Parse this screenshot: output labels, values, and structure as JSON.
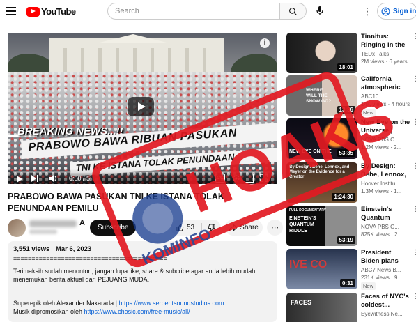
{
  "header": {
    "logo_text": "YouTube",
    "search_placeholder": "Search",
    "signin_label": "Sign in"
  },
  "player": {
    "breaking_text": "BREAKING NEWS...!!",
    "banner_line1": "PRABOWO BAWA RIBUAN PASUKAN",
    "banner_line2": "TNI KE ISTANA TOLAK PENUNDAAN",
    "time": "0:00 / 5:",
    "progress": 0.0
  },
  "video": {
    "title": "PRABOWO BAWA PASUKAN TNI KE ISTANA TOLAK PENUNDAAN PEMILU",
    "channel_suffix": "A",
    "subscribe_label": "Subscribe",
    "likes": "53",
    "share_label": "Share"
  },
  "description": {
    "views": "3,551 views",
    "date": "Mar 6, 2023",
    "separator": "==========================================",
    "paragraph": "Terimaksih sudah menonton, jangan lupa like, share & subcribe agar anda lebih mudah menemukan berita aktual dari PEJUANG MUDA.",
    "credit1_prefix": "Superepik oleh Alexander Nakarada | ",
    "credit1_link": "https://www.serpentsoundstudios.com",
    "credit2_prefix": "Musik dipromosikan oleh ",
    "credit2_link": "https://www.chosic.com/free-music/all/"
  },
  "recommendations": [
    {
      "title": "Tinnitus: Ringing in the Brain |",
      "channel": "TEDx Talks",
      "meta": "2M views · 6 years",
      "badge": "",
      "duration": "18:01"
    },
    {
      "title": "California atmospheric riv...",
      "channel": "ABC10",
      "meta": "14K views · 4 hours",
      "badge": "New",
      "duration": "13:36"
    },
    {
      "title": "New Eye on the Universe | Full...",
      "channel": "NOVA PBS O...",
      "meta": "1.2M views · 2...",
      "badge": "",
      "duration": "53:35"
    },
    {
      "title": "By Design: Behe, Lennox, and...",
      "channel": "Hoover Institu...",
      "meta": "1.3M views · 1...",
      "badge": "",
      "duration": "1:24:30"
    },
    {
      "title": "Einstein's Quantum Riddle...",
      "channel": "NOVA PBS O...",
      "meta": "825K views · 2...",
      "badge": "",
      "duration": "53:19"
    },
    {
      "title": "President Biden plans new taxes...",
      "channel": "ABC7 News B...",
      "meta": "231K views · 9...",
      "badge": "New",
      "duration": "0:31"
    },
    {
      "title": "Faces of NYC's coldest...",
      "channel": "Eyewitness Ne...",
      "meta": "",
      "badge": "",
      "duration": ""
    }
  ],
  "thumb_text": {
    "t2": "WHERE WILL THE SNOW GO?",
    "t3": "NEW EYE ON THE",
    "t4": "By Design: Behe, Lennox, and Meyer on the Evidence for a Creator",
    "t5a": "FULL DOCUMENTARY",
    "t5b": "EINSTEIN'S QUANTUM RIDDLE",
    "t6": "IVE CO",
    "t7": "FACES"
  },
  "stamp": {
    "text": "HOAKS",
    "logo_text": "KOMINFO",
    "color": "#e21a22"
  },
  "colors": {
    "brand_red": "#ff0000",
    "link_blue": "#065fd4"
  }
}
